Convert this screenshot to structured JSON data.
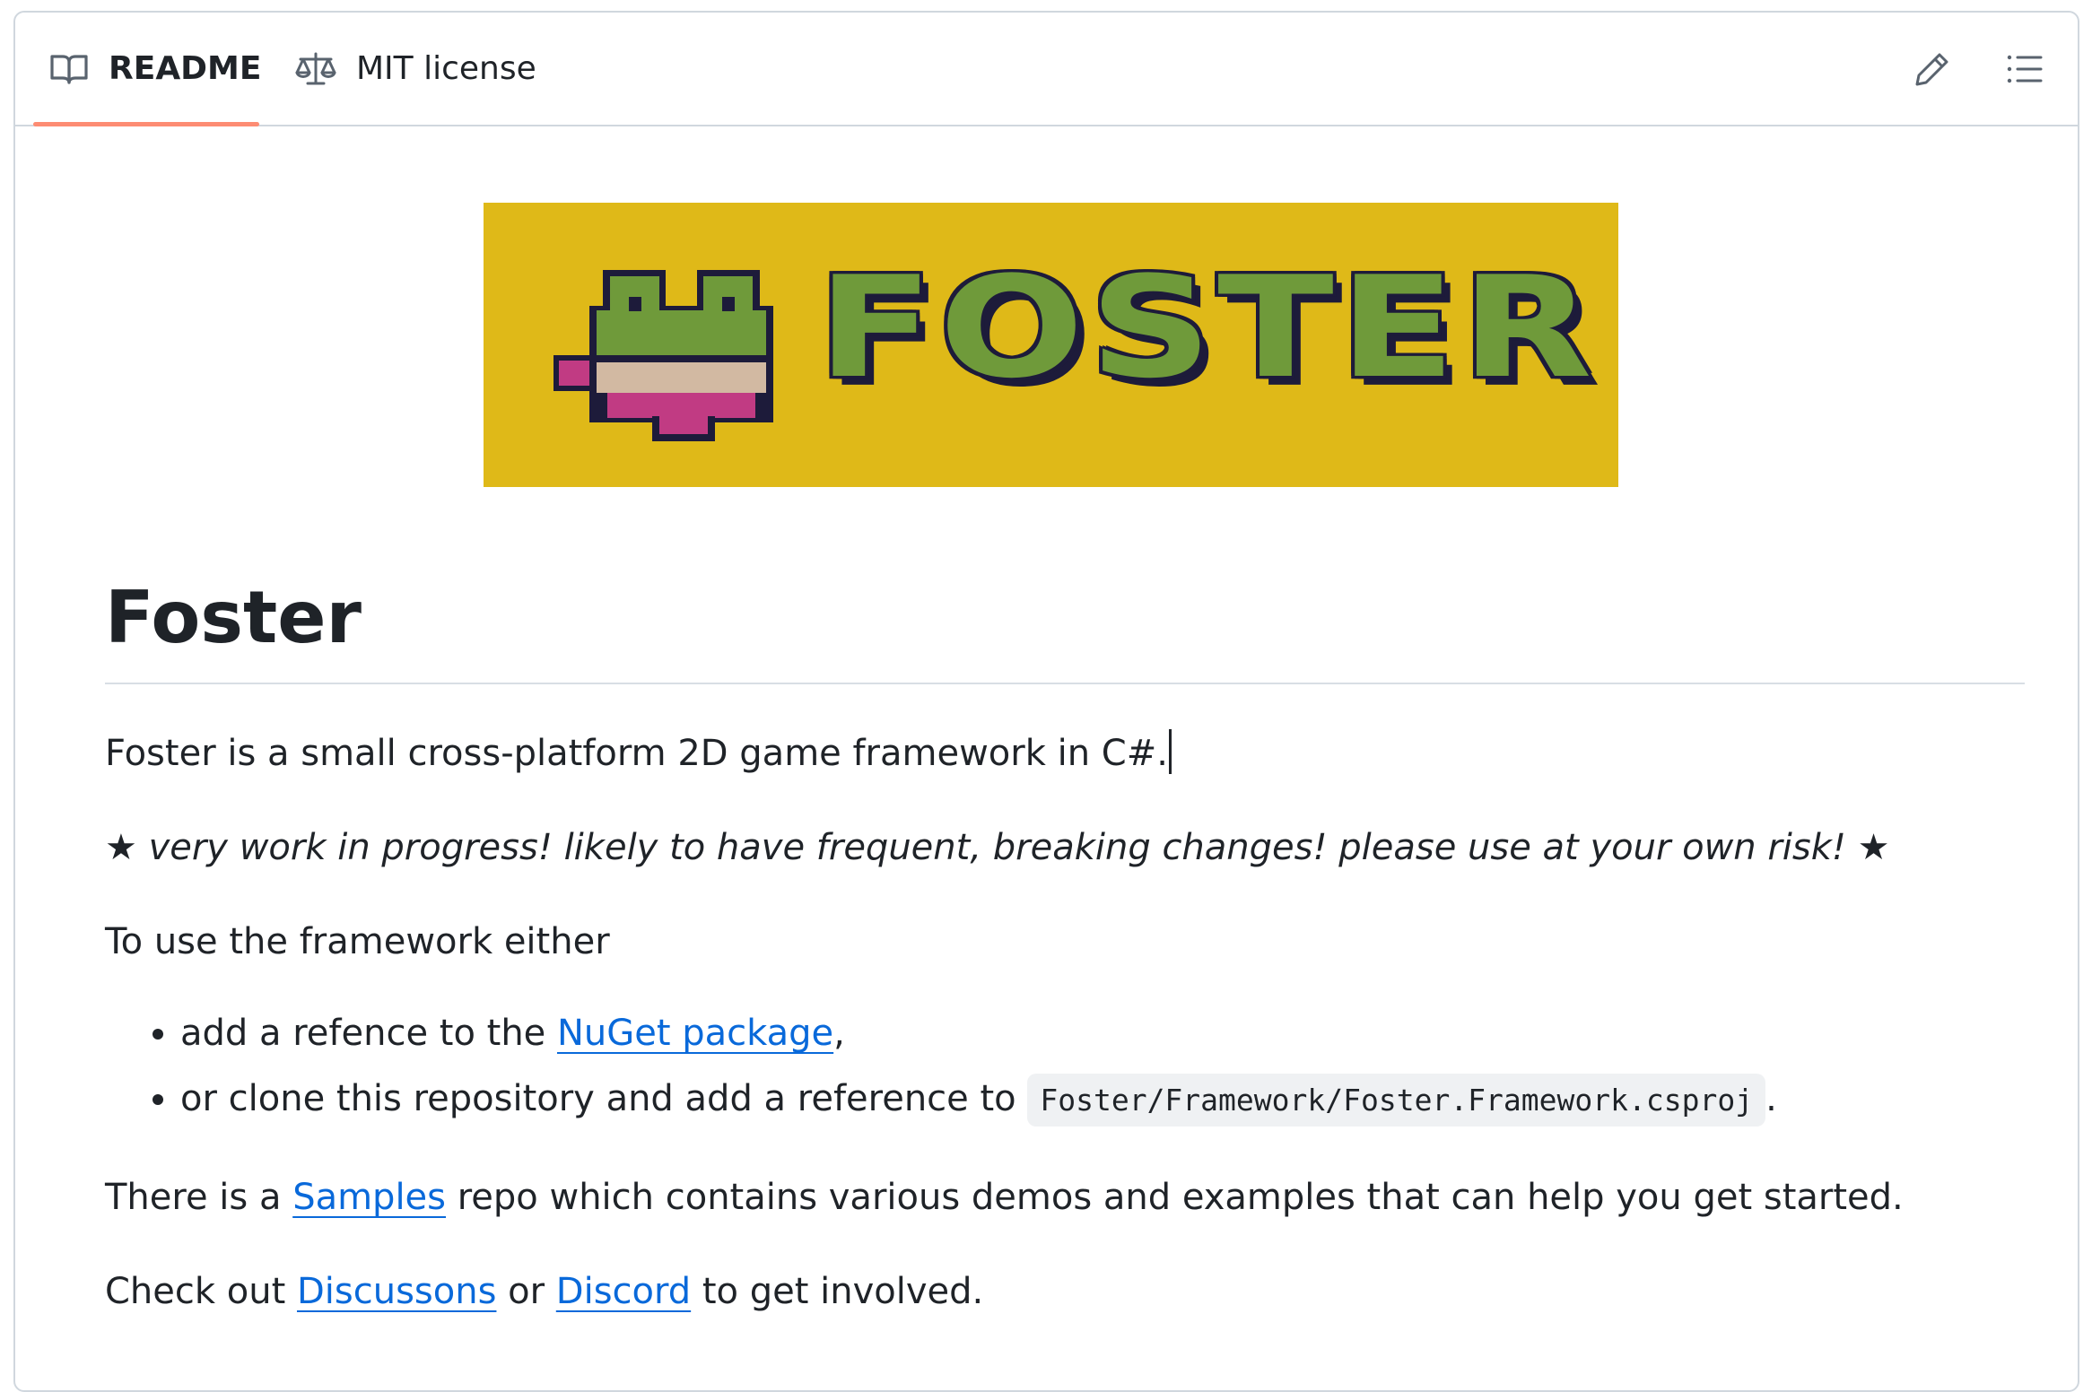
{
  "tabs": {
    "readme_label": "README",
    "license_label": "MIT license"
  },
  "toolbar": {
    "edit_icon": "pencil-icon",
    "toc_icon": "list-unordered-icon"
  },
  "banner": {
    "wordmark": "FOSTER",
    "logo": "frog-mascot",
    "background_color": "#dfb918"
  },
  "readme": {
    "title": "Foster",
    "intro": "Foster is a small cross-platform 2D game framework in C#.",
    "warning": "★ very work in progress! likely to have frequent, breaking changes! please use at your own risk! ★",
    "usage_intro": "To use the framework either",
    "list": [
      {
        "before": "add a refence to the ",
        "link": "NuGet package",
        "after": ","
      },
      {
        "before": "or clone this repository and add a reference to ",
        "code": "Foster/Framework/Foster.Framework.csproj",
        "after": "."
      }
    ],
    "samples": {
      "before": "There is a ",
      "link": "Samples",
      "after": " repo which contains various demos and examples that can help you get started."
    },
    "community": {
      "before": "Check out ",
      "link1": "Discussons",
      "middle": " or ",
      "link2": "Discord",
      "after": " to get involved."
    }
  },
  "colors": {
    "link": "#0969da",
    "tab_underline": "#fd8c73",
    "border": "#d0d7de",
    "text": "#1f2328"
  }
}
